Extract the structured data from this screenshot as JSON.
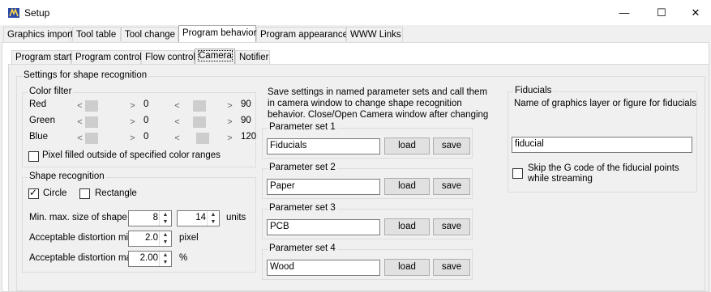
{
  "window": {
    "title": "Setup",
    "minimize": "—",
    "maximize": "☐",
    "close": "✕"
  },
  "main_tabs": [
    "Graphics import",
    "Tool table",
    "Tool change",
    "Program behavior",
    "Program appearance",
    "WWW Links"
  ],
  "sub_tabs": [
    "Program start",
    "Program control",
    "Flow control",
    "Camera",
    "Notifier"
  ],
  "settings_group": "Settings for shape recognition",
  "color_filter": {
    "title": "Color filter",
    "rows": [
      {
        "label": "Red",
        "min": "0",
        "max": "90",
        "min_frac": 0.0,
        "max_frac": 0.35
      },
      {
        "label": "Green",
        "min": "0",
        "max": "90",
        "min_frac": 0.0,
        "max_frac": 0.35
      },
      {
        "label": "Blue",
        "min": "0",
        "max": "120",
        "min_frac": 0.0,
        "max_frac": 0.47
      }
    ],
    "outside_label": "Pixel filled outside of specified color ranges",
    "outside_checked": false
  },
  "shape_recognition": {
    "title": "Shape recognition",
    "circle_label": "Circle",
    "circle_checked": true,
    "rectangle_label": "Rectangle",
    "rectangle_checked": false,
    "size_label": "Min. max. size of shape",
    "size_min": "8",
    "size_max": "14",
    "size_units": "units",
    "dist_min_label": "Acceptable distortion min.",
    "dist_min": "2.0",
    "dist_min_unit": "pixel",
    "dist_max_label": "Acceptable distortion max.",
    "dist_max": "2.00",
    "dist_max_unit": "%"
  },
  "param_info": "Save settings in named parameter sets and call them in camera window to change shape recognition behavior. Close/Open Camera window after changing names.",
  "param_sets": [
    {
      "title": "Parameter set 1",
      "value": "Fiducials"
    },
    {
      "title": "Parameter set 2",
      "value": "Paper"
    },
    {
      "title": "Parameter set 3",
      "value": "PCB"
    },
    {
      "title": "Parameter set 4",
      "value": "Wood"
    }
  ],
  "load_label": "load",
  "save_label": "save",
  "fiducials": {
    "title": "Fiducials",
    "description": "Name of graphics layer or figure for fiducials",
    "value": "fiducial",
    "skip_label_1": "Skip the G code of the fiducial points",
    "skip_label_2": "while streaming",
    "skip_checked": false
  },
  "arrows": {
    "left": "<",
    "right": ">"
  }
}
